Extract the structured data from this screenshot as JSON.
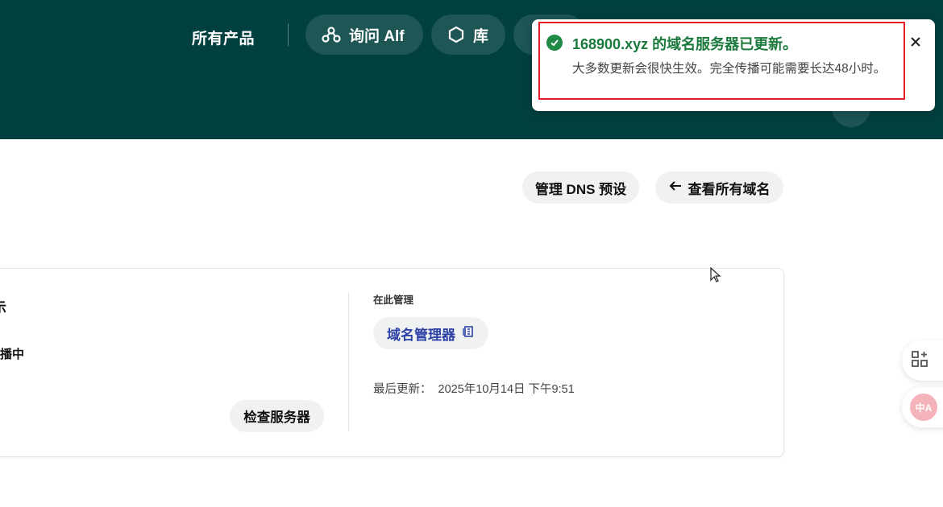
{
  "header": {
    "all_products": "所有产品",
    "nav": [
      {
        "label": "询问 Alf",
        "icon": "alf-icon"
      },
      {
        "label": "库",
        "icon": "hexagon-icon"
      },
      {
        "label": "",
        "icon": "tools-icon"
      }
    ]
  },
  "toast": {
    "status": "success",
    "title": "168900.xyz 的域名服务器已更新。",
    "message": "大多数更新会很快生效。完全传播可能需要长达48小时。",
    "close_icon": "close-icon"
  },
  "actions": {
    "manage_dns": "管理 DNS 预设",
    "view_all": "查看所有域名"
  },
  "card": {
    "left_fragment_1": "示",
    "left_fragment_2": "播中",
    "check_button": "检查服务器",
    "manage_here_label": "在此管理",
    "registrar_button": "域名管理器",
    "last_updated_label": "最后更新：",
    "last_updated_value": "2025年10月14日 下午9:51"
  },
  "side": {
    "translate_badge": "中A"
  },
  "colors": {
    "header_bg": "#00403f",
    "success_green": "#1e8a45",
    "link_blue": "#2c41a8",
    "highlight_red": "#e11c24"
  }
}
